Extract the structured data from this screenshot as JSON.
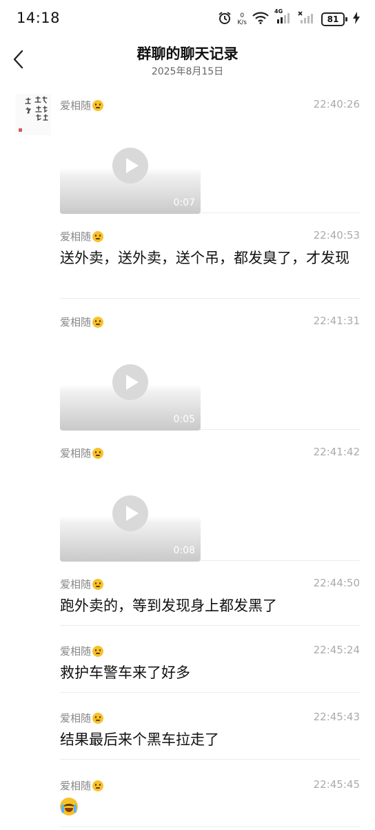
{
  "status_bar": {
    "time": "14:18",
    "net_speed_value": "0",
    "net_speed_unit": "K/s",
    "network_type": "4G",
    "battery_level": "81"
  },
  "header": {
    "title": "群聊的聊天记录",
    "date": "2025年8月15日"
  },
  "messages": [
    {
      "sender": "爱相随",
      "time": "22:40:26",
      "type": "video",
      "duration": "0:07"
    },
    {
      "sender": "爱相随",
      "time": "22:40:53",
      "type": "text",
      "text": "送外卖，送外卖，送个吊，都发臭了，才发现"
    },
    {
      "sender": "爱相随",
      "time": "22:41:31",
      "type": "video",
      "duration": "0:05"
    },
    {
      "sender": "爱相随",
      "time": "22:41:42",
      "type": "video",
      "duration": "0:08"
    },
    {
      "sender": "爱相随",
      "time": "22:44:50",
      "type": "text",
      "text": "跑外卖的，等到发现身上都发黑了"
    },
    {
      "sender": "爱相随",
      "time": "22:45:24",
      "type": "text",
      "text": "救护车警车来了好多"
    },
    {
      "sender": "爱相随",
      "time": "22:45:43",
      "type": "text",
      "text": "结果最后来个黑车拉走了"
    },
    {
      "sender": "爱相随",
      "time": "22:45:45",
      "type": "emoji",
      "emoji": "loudly-crying-face"
    }
  ],
  "icons": {
    "sender_emoji": "shushing-face-icon",
    "back": "chevron-left-icon"
  }
}
